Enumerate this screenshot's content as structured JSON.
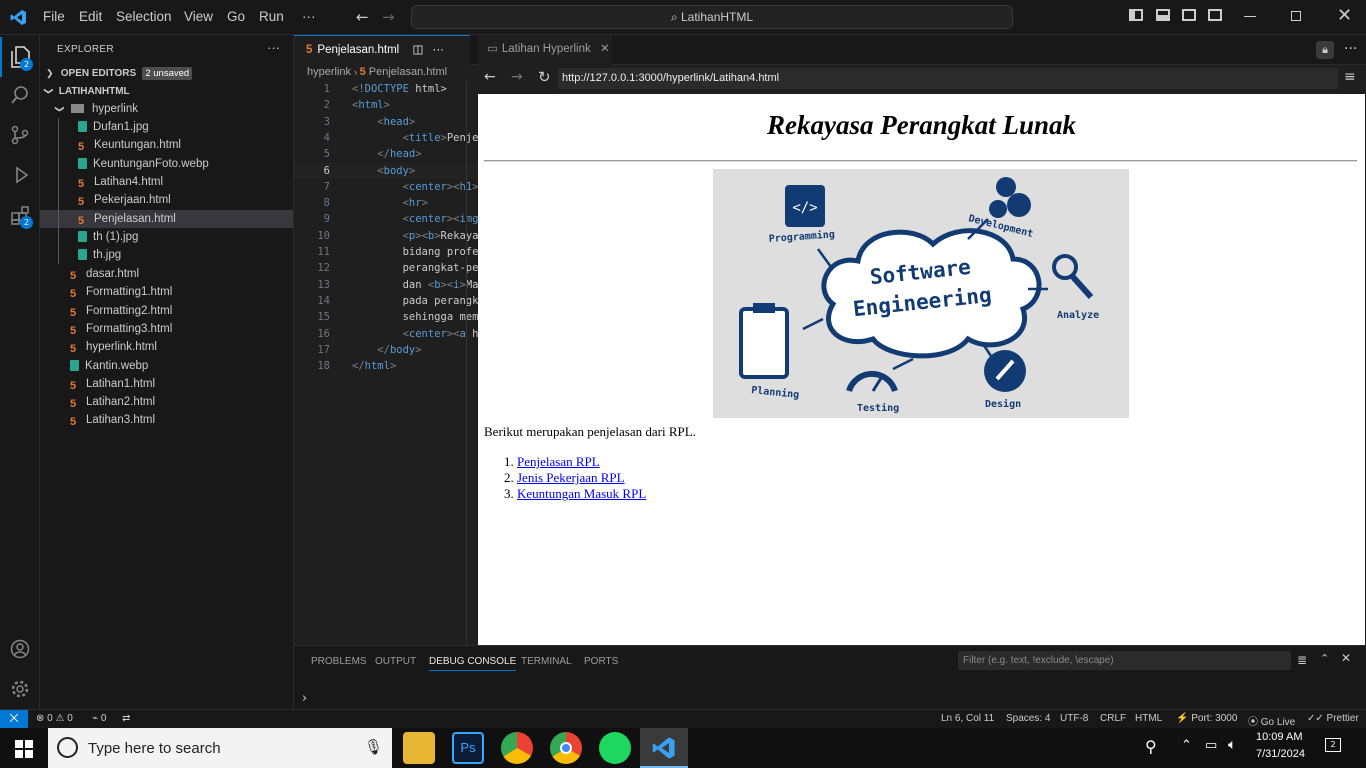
{
  "menu": [
    "File",
    "Edit",
    "Selection",
    "View",
    "Go",
    "Run",
    "···"
  ],
  "command_center": "LatihanHTML",
  "explorer": {
    "title": "EXPLORER",
    "open_editors": "OPEN EDITORS",
    "unsaved_badge": "2 unsaved",
    "workspace": "LATIHANHTML",
    "folder": "hyperlink",
    "folder_files": [
      {
        "name": "Dufan1.jpg",
        "kind": "img"
      },
      {
        "name": "Keuntungan.html",
        "kind": "html"
      },
      {
        "name": "KeuntunganFoto.webp",
        "kind": "img"
      },
      {
        "name": "Latihan4.html",
        "kind": "html"
      },
      {
        "name": "Pekerjaan.html",
        "kind": "html"
      },
      {
        "name": "Penjelasan.html",
        "kind": "html"
      },
      {
        "name": "th (1).jpg",
        "kind": "img"
      },
      {
        "name": "th.jpg",
        "kind": "img"
      }
    ],
    "root_files": [
      {
        "name": "dasar.html",
        "kind": "html"
      },
      {
        "name": "Formatting1.html",
        "kind": "html"
      },
      {
        "name": "Formatting2.html",
        "kind": "html"
      },
      {
        "name": "Formatting3.html",
        "kind": "html"
      },
      {
        "name": "hyperlink.html",
        "kind": "html"
      },
      {
        "name": "Kantin.webp",
        "kind": "img"
      },
      {
        "name": "Latihan1.html",
        "kind": "html"
      },
      {
        "name": "Latihan2.html",
        "kind": "html"
      },
      {
        "name": "Latihan3.html",
        "kind": "html"
      }
    ],
    "badges": {
      "explorer": "2",
      "extensions": "2"
    }
  },
  "editor": {
    "tab": "Penjelasan.html",
    "breadcrumb": [
      "hyperlink",
      "Penjelasan.html"
    ],
    "lines": [
      {
        "n": "1",
        "code": "<!DOCTYPE html>"
      },
      {
        "n": "2",
        "code": "<html>"
      },
      {
        "n": "3",
        "code": "    <head>"
      },
      {
        "n": "4",
        "code": "        <title>Penje"
      },
      {
        "n": "5",
        "code": "    </head>"
      },
      {
        "n": "6",
        "code": "    <body>"
      },
      {
        "n": "7",
        "code": "        <center><h1>"
      },
      {
        "n": "8",
        "code": "        <hr>"
      },
      {
        "n": "9",
        "code": "        <center><img"
      },
      {
        "n": "10",
        "code": "        <p><b>Rekaya"
      },
      {
        "n": "11",
        "code": "        bidang profe"
      },
      {
        "n": "12",
        "code": "        perangkat-pe"
      },
      {
        "n": "13",
        "code": "        dan <b><i>Ma"
      },
      {
        "n": "14",
        "code": "        pada perangk"
      },
      {
        "n": "15",
        "code": "        sehingga mem"
      },
      {
        "n": "16",
        "code": "        <center><a h"
      },
      {
        "n": "17",
        "code": "    </body>"
      },
      {
        "n": "18",
        "code": "</html>"
      }
    ]
  },
  "preview": {
    "tab": "Latihan Hyperlink",
    "url": "http://127.0.0.1:3000/hyperlink/Latihan4.html",
    "heading": "Rekayasa Perangkat Lunak",
    "figure_title_1": "Software",
    "figure_title_2": "Engineering",
    "figure_labels": [
      "Programming",
      "Development",
      "Analyze",
      "Design",
      "Testing",
      "Planning"
    ],
    "paragraph": "Berikut merupakan penjelasan dari RPL.",
    "links": [
      "Penjelasan RPL",
      "Jenis Pekerjaan RPL",
      "Keuntungan Masuk RPL"
    ]
  },
  "panel": {
    "tabs": [
      "PROBLEMS",
      "OUTPUT",
      "DEBUG CONSOLE",
      "TERMINAL",
      "PORTS"
    ],
    "active": "DEBUG CONSOLE",
    "filter_placeholder": "Filter (e.g. text, !exclude, \\escape)"
  },
  "status": {
    "errors": "0",
    "warnings": "0",
    "ports_count": "0",
    "position": "Ln 6, Col 11",
    "spaces": "Spaces: 4",
    "encoding": "UTF-8",
    "eol": "CRLF",
    "language": "HTML",
    "port": "Port: 3000",
    "golive": "Go Live",
    "prettier": "Prettier"
  },
  "taskbar": {
    "search_placeholder": "Type here to search",
    "time": "10:09 AM",
    "date": "7/31/2024",
    "notifications": "2"
  },
  "colors": {
    "accent": "#0078d4",
    "statusbar": "#181818"
  }
}
